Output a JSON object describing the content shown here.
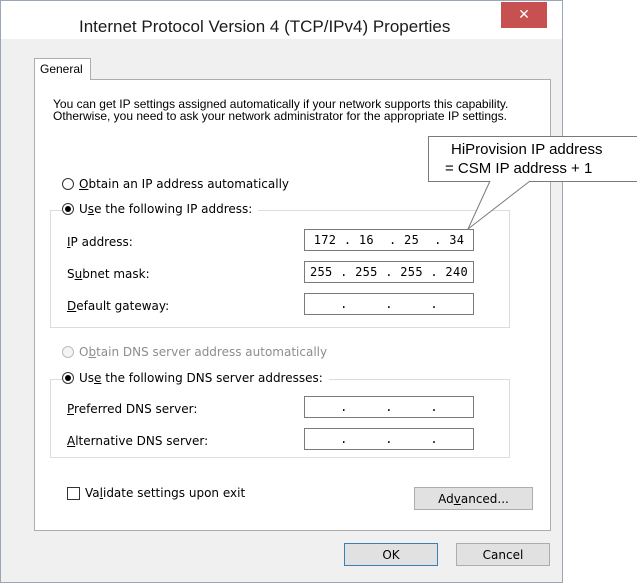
{
  "window": {
    "title": "Internet Protocol Version 4 (TCP/IPv4) Properties",
    "close_glyph": "✕"
  },
  "tabs": [
    {
      "label": "General"
    }
  ],
  "description": "You can get IP settings assigned automatically if your network supports this capability. Otherwise, you need to ask your network administrator for the appropriate IP settings.",
  "ip_settings": {
    "auto_option": {
      "before": "",
      "accel": "O",
      "after": "btain an IP address automatically",
      "checked": false
    },
    "manual_option": {
      "before": "U",
      "accel": "s",
      "after": "e the following IP address:",
      "checked": true
    },
    "fields": [
      {
        "label_before": "",
        "accel": "I",
        "label_after": "P address:",
        "value": "172 . 16  . 25  . 34"
      },
      {
        "label_before": "S",
        "accel": "u",
        "label_after": "bnet mask:",
        "value": "255 . 255 . 255 . 240"
      },
      {
        "label_before": "",
        "accel": "D",
        "label_after": "efault gateway:",
        "value": ".     .     ."
      }
    ]
  },
  "dns_settings": {
    "auto_option": {
      "before": "O",
      "accel": "b",
      "after": "tain DNS server address automatically",
      "checked": false,
      "disabled": true
    },
    "manual_option": {
      "before": "Us",
      "accel": "e",
      "after": " the following DNS server addresses:",
      "checked": true
    },
    "fields": [
      {
        "label_before": "",
        "accel": "P",
        "label_after": "referred DNS server:",
        "value": ".     .     ."
      },
      {
        "label_before": "",
        "accel": "A",
        "label_after": "lternative DNS server:",
        "value": ".     .     ."
      }
    ]
  },
  "validate": {
    "before": "Va",
    "accel": "l",
    "after": "idate settings upon exit",
    "checked": false
  },
  "buttons": {
    "advanced": {
      "before": "Ad",
      "accel": "v",
      "after": "anced..."
    },
    "ok": "OK",
    "cancel": "Cancel"
  },
  "callout": {
    "line1": "HiProvision IP address",
    "line2": "= CSM IP address + 1"
  },
  "colors": {
    "close_button": "#c75050",
    "window_bg": "#f0f0f0",
    "default_button_border": "#3c7fb1"
  }
}
